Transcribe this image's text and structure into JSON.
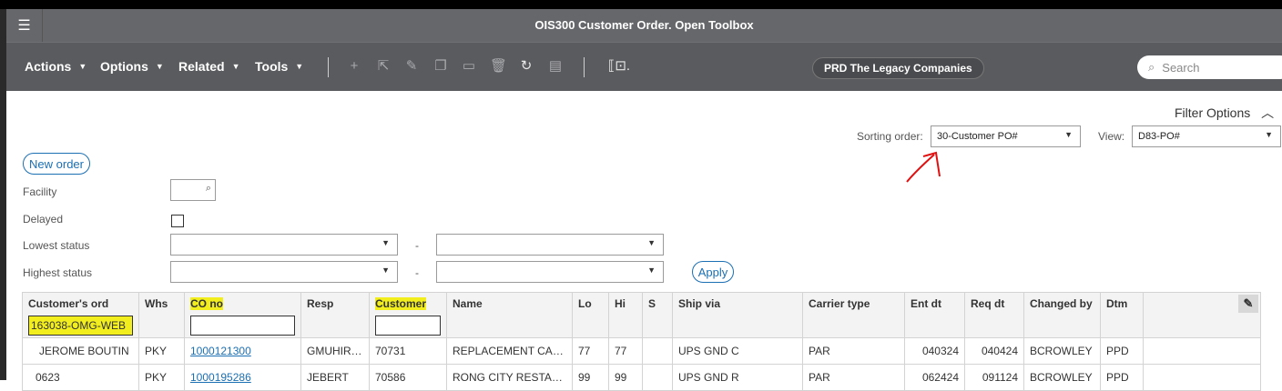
{
  "window": {
    "title": "OIS300 Customer Order. Open Toolbox"
  },
  "toolbar": {
    "menus": [
      "Actions",
      "Options",
      "Related",
      "Tools"
    ],
    "environment": "PRD The Legacy Companies",
    "search_placeholder": "Search"
  },
  "filter": {
    "filter_options_label": "Filter Options",
    "sorting_order_label": "Sorting order:",
    "sorting_order_value": "30-Customer PO#",
    "view_label": "View:",
    "view_value": "D83-PO#",
    "new_order_label": "New order",
    "facility_label": "Facility",
    "delayed_label": "Delayed",
    "lowest_status_label": "Lowest status",
    "highest_status_label": "Highest status",
    "range_dash": "-",
    "apply_label": "Apply"
  },
  "grid": {
    "columns": [
      "Customer's ord",
      "Whs",
      "CO no",
      "Resp",
      "Customer",
      "Name",
      "Lo",
      "Hi",
      "S",
      "Ship via",
      "Carrier type",
      "Ent dt",
      "Req dt",
      "Changed by",
      "Dtm"
    ],
    "filters": {
      "customers_ord": "163038-OMG-WEB"
    },
    "rows": [
      [
        "JEROME BOUTIN",
        "PKY",
        "1000121300",
        "GMUHIRWA",
        "70731",
        "REPLACEMENT CARE",
        "77",
        "77",
        "",
        "UPS GND C",
        "PAR",
        "040324",
        "040424",
        "BCROWLEY",
        "PPD"
      ],
      [
        "0623",
        "PKY",
        "1000195286",
        "JEBERT",
        "70586",
        "RONG CITY RESTAURANT",
        "99",
        "99",
        "",
        "UPS GND R",
        "PAR",
        "062424",
        "091124",
        "BCROWLEY",
        "PPD"
      ]
    ]
  },
  "colors": {
    "highlight": "#f2ee1e",
    "annotation": "#e01010",
    "link": "#1b6fb3"
  }
}
